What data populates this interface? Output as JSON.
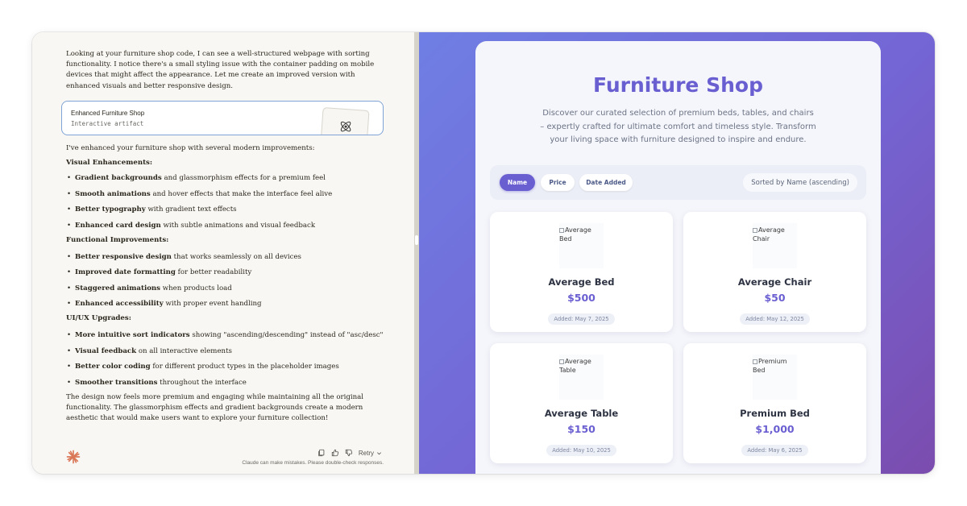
{
  "chat": {
    "intro": "Looking at your furniture shop code, I can see a well-structured webpage with sorting functionality. I notice there's a small styling issue with the container padding on mobile devices that might affect the appearance. Let me create an improved version with enhanced visuals and better responsive design.",
    "artifact": {
      "title": "Enhanced Furniture Shop",
      "subtitle": "Interactive artifact",
      "icon": "atom-icon"
    },
    "lead": "I've enhanced your furniture shop with several modern improvements:",
    "sections": [
      {
        "heading": "Visual Enhancements:",
        "items": [
          {
            "bold": "Gradient backgrounds",
            "rest": " and glassmorphism effects for a premium feel"
          },
          {
            "bold": "Smooth animations",
            "rest": " and hover effects that make the interface feel alive"
          },
          {
            "bold": "Better typography",
            "rest": " with gradient text effects"
          },
          {
            "bold": "Enhanced card design",
            "rest": " with subtle animations and visual feedback"
          }
        ]
      },
      {
        "heading": "Functional Improvements:",
        "items": [
          {
            "bold": "Better responsive design",
            "rest": " that works seamlessly on all devices"
          },
          {
            "bold": "Improved date formatting",
            "rest": " for better readability"
          },
          {
            "bold": "Staggered animations",
            "rest": " when products load"
          },
          {
            "bold": "Enhanced accessibility",
            "rest": " with proper event handling"
          }
        ]
      },
      {
        "heading": "UI/UX Upgrades:",
        "items": [
          {
            "bold": "More intuitive sort indicators",
            "rest": " showing \"ascending/descending\" instead of \"asc/desc\""
          },
          {
            "bold": "Visual feedback",
            "rest": " on all interactive elements"
          },
          {
            "bold": "Better color coding",
            "rest": " for different product types in the placeholder images"
          },
          {
            "bold": "Smoother transitions",
            "rest": " throughout the interface"
          }
        ]
      }
    ],
    "closing": "The design now feels more premium and engaging while maintaining all the original functionality. The glassmorphism effects and gradient backgrounds create a modern aesthetic that would make users want to explore your furniture collection!",
    "footer": {
      "retry_label": "Retry",
      "disclaimer": "Claude can make mistakes. Please double-check responses."
    }
  },
  "shop": {
    "title": "Furniture Shop",
    "description": "Discover our curated selection of premium beds, tables, and chairs – expertly crafted for ultimate comfort and timeless style. Transform your living space with furniture designed to inspire and endure.",
    "sort_buttons": [
      {
        "label": "Name",
        "active": true
      },
      {
        "label": "Price",
        "active": false
      },
      {
        "label": "Date Added",
        "active": false
      }
    ],
    "sort_status": "Sorted by Name (ascending)",
    "products": [
      {
        "alt": "Average Bed",
        "name": "Average Bed",
        "price": "$500",
        "date": "Added: May 7, 2025"
      },
      {
        "alt": "Average Chair",
        "name": "Average Chair",
        "price": "$50",
        "date": "Added: May 12, 2025"
      },
      {
        "alt": "Average Table",
        "name": "Average Table",
        "price": "$150",
        "date": "Added: May 10, 2025"
      },
      {
        "alt": "Premium Bed",
        "name": "Premium Bed",
        "price": "$1,000",
        "date": "Added: May 6, 2025"
      }
    ]
  },
  "colors": {
    "accent": "#6a5fd1",
    "claude_orange": "#d97757",
    "artifact_border": "#7fa3d6"
  }
}
